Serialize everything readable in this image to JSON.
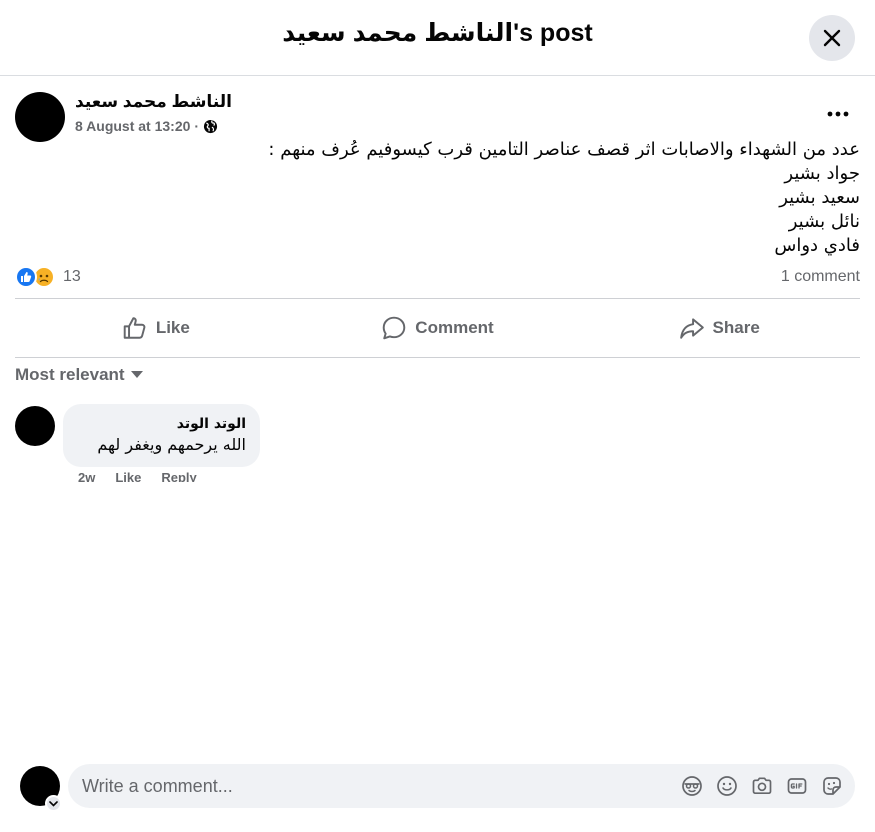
{
  "header": {
    "title": "الناشط محمد سعيد's post"
  },
  "post": {
    "author": "الناشط محمد سعيد",
    "timestamp": "8 August at 13:20",
    "separator": "·",
    "privacy_icon": "globe-icon",
    "body_lines": [
      "عدد من الشهداء والاصابات اثر قصف عناصر التامين قرب كيسوفيم عُرف منهم :",
      "جواد بشير",
      "سعيد بشير",
      "نائل بشير",
      "فادي دواس"
    ],
    "reaction_icons": [
      "like-reaction-icon",
      "sad-reaction-icon"
    ],
    "reaction_count": "13",
    "comment_count": "1 comment"
  },
  "actions": {
    "like": "Like",
    "comment": "Comment",
    "share": "Share"
  },
  "comments": {
    "sort_label": "Most relevant",
    "items": [
      {
        "author": "الوتد الوتد",
        "text": "الله يرحمهم ويغفر لهم",
        "age": "2w",
        "like": "Like",
        "reply": "Reply"
      }
    ]
  },
  "composer": {
    "placeholder": "Write a comment...",
    "tools": [
      "avatar-sticker-icon",
      "emoji-icon",
      "camera-icon",
      "gif-icon",
      "sticker-icon"
    ]
  },
  "colors": {
    "accent": "#1877f2",
    "secondary_text": "#65676b",
    "surface": "#f0f2f5"
  }
}
